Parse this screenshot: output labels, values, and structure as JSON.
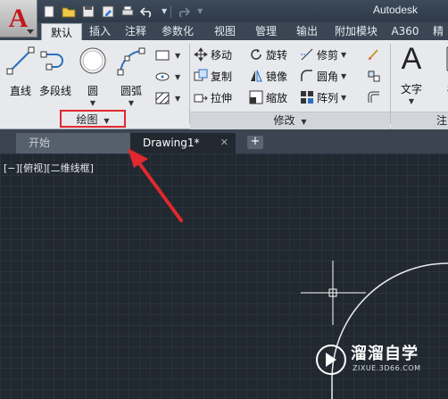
{
  "title_bar": {
    "app_logo_letter": "A",
    "app_title": "Autodesk",
    "quick_access": [
      "new-icon",
      "open-icon",
      "save-icon",
      "save-as-icon",
      "print-icon",
      "undo-icon",
      "redo-icon"
    ]
  },
  "ribbon_tabs": [
    {
      "label": "默认",
      "active": true
    },
    {
      "label": "插入"
    },
    {
      "label": "注释"
    },
    {
      "label": "参数化"
    },
    {
      "label": "视图"
    },
    {
      "label": "管理"
    },
    {
      "label": "输出"
    },
    {
      "label": "附加模块"
    },
    {
      "label": "A360"
    },
    {
      "label": "精"
    }
  ],
  "draw_panel": {
    "title": "绘图",
    "buttons": [
      {
        "label": "直线",
        "icon": "line-icon"
      },
      {
        "label": "多段线",
        "icon": "polyline-icon"
      },
      {
        "label": "圆",
        "icon": "circle-icon"
      },
      {
        "label": "圆弧",
        "icon": "arc-icon"
      }
    ]
  },
  "modify_panel": {
    "title": "修改",
    "tools": [
      {
        "label": "移动",
        "icon": "move-icon"
      },
      {
        "label": "旋转",
        "icon": "rotate-icon"
      },
      {
        "label": "修剪",
        "icon": "trim-icon"
      },
      {
        "label": "复制",
        "icon": "copy-icon"
      },
      {
        "label": "镜像",
        "icon": "mirror-icon"
      },
      {
        "label": "圆角",
        "icon": "fillet-icon"
      },
      {
        "label": "拉伸",
        "icon": "stretch-icon"
      },
      {
        "label": "缩放",
        "icon": "scale-icon"
      },
      {
        "label": "阵列",
        "icon": "array-icon"
      }
    ]
  },
  "annotation_panel": {
    "title": "注",
    "buttons": [
      {
        "label": "文字",
        "icon": "text-icon"
      },
      {
        "label": "标",
        "icon": "dimension-icon"
      }
    ]
  },
  "file_tabs": {
    "start": "开始",
    "drawing": "Drawing1*",
    "close": "✕",
    "new": "+"
  },
  "viewport": {
    "label": "[−][俯视][二维线框]"
  },
  "watermark": {
    "title": "溜溜自学",
    "url": "ZIXUE.3D66.COM"
  },
  "colors": {
    "highlight_box": "#e0282e",
    "arrow": "#e0282e",
    "canvas_bg": "#212830"
  }
}
